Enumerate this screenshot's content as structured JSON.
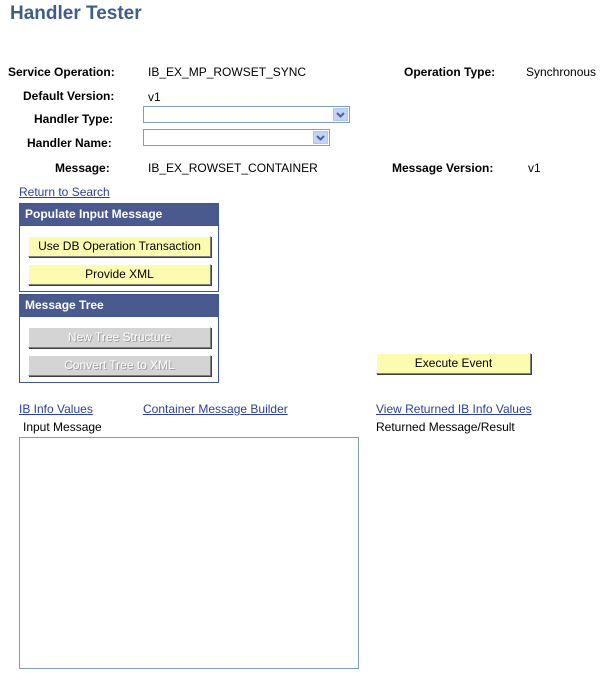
{
  "page": {
    "title": "Handler Tester"
  },
  "fields": {
    "service_operation_label": "Service Operation:",
    "service_operation_value": "IB_EX_MP_ROWSET_SYNC",
    "operation_type_label": "Operation Type:",
    "operation_type_value": "Synchronous",
    "default_version_label": "Default Version:",
    "default_version_value": "v1",
    "handler_type_label": "Handler Type:",
    "handler_type_value": "",
    "handler_name_label": "Handler Name:",
    "handler_name_value": "",
    "message_label": "Message:",
    "message_value": "IB_EX_ROWSET_CONTAINER",
    "message_version_label": "Message Version:",
    "message_version_value": "v1"
  },
  "links": {
    "return_to_search": "Return to Search",
    "ib_info_values": "IB Info Values",
    "container_message_builder": "Container Message Builder",
    "view_returned_ib_info_values": "View Returned IB Info Values"
  },
  "populate_group": {
    "header": "Populate Input Message",
    "use_db_button": "Use DB Operation Transaction",
    "provide_xml_button": "Provide XML"
  },
  "tree_group": {
    "header": "Message Tree",
    "new_tree_button": "New Tree Structure",
    "convert_tree_button": "Convert Tree to XML"
  },
  "execute_button": "Execute Event",
  "input_message_label": "Input Message",
  "input_message_value": "",
  "returned_message_label": "Returned Message/Result",
  "icons": {
    "dropdown": "chevron-down-icon"
  }
}
